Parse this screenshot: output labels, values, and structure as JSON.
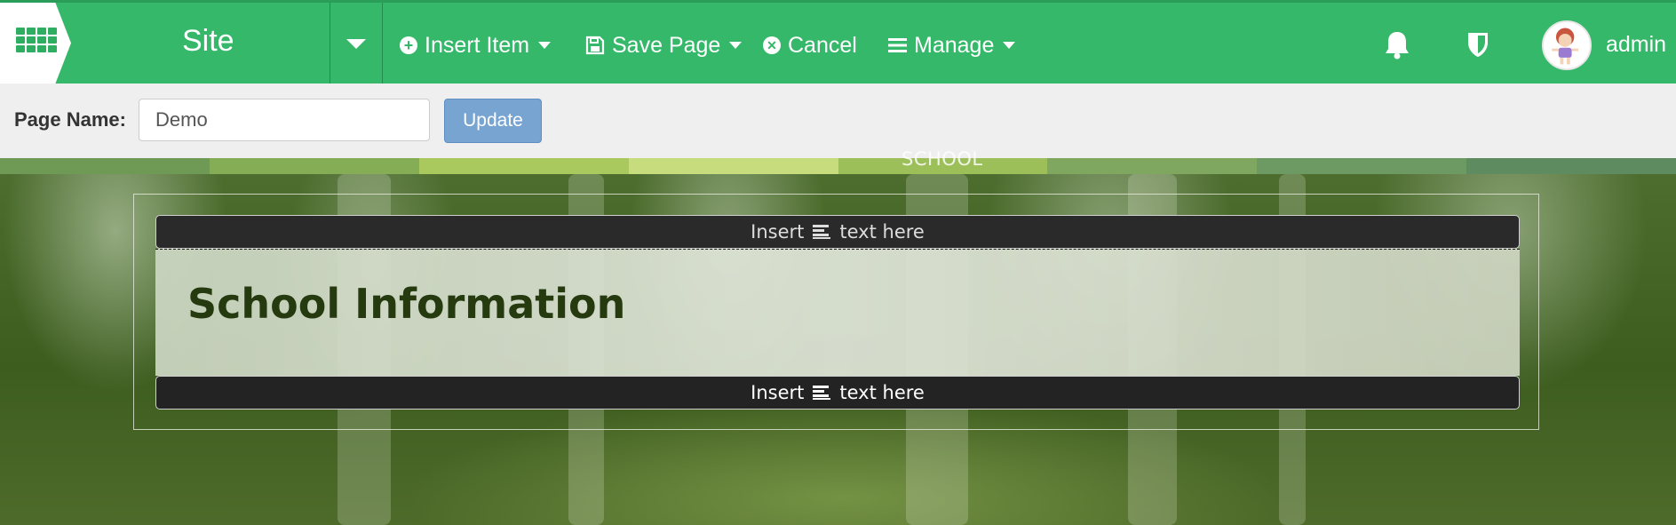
{
  "topbar": {
    "site_title": "Site",
    "menu": {
      "insert_item": "Insert Item",
      "save_page": "Save Page",
      "cancel": "Cancel",
      "manage": "Manage"
    },
    "user_name": "admin",
    "icons": [
      "apps-grid-icon",
      "chevron-down-icon",
      "plus-circle-icon",
      "save-icon",
      "close-circle-icon",
      "hamburger-icon",
      "bell-icon",
      "shield-icon"
    ],
    "colors": {
      "bar": "#36b86a",
      "accent_dark": "#238c4c"
    }
  },
  "page_name_bar": {
    "label": "Page Name:",
    "input_value": "Demo",
    "update_label": "Update"
  },
  "site_nav": {
    "visible_item": "SCHOOL"
  },
  "editor": {
    "insert_top": {
      "prefix": "Insert",
      "suffix": "text here"
    },
    "heading": "School Information",
    "insert_bottom": {
      "prefix": "Insert",
      "suffix": "text here"
    }
  }
}
